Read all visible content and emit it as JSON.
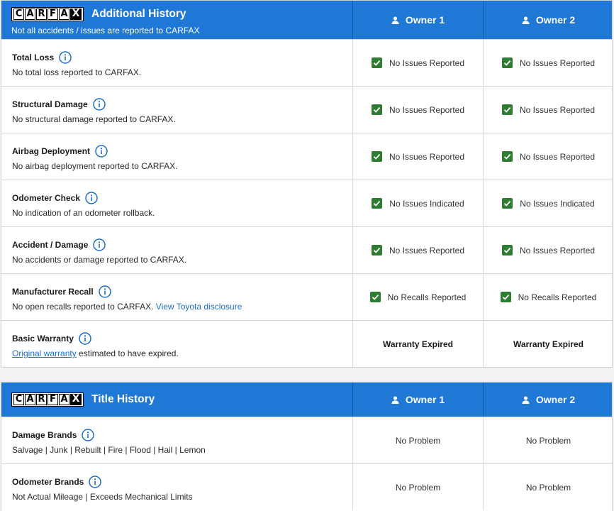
{
  "colors": {
    "header_blue": "#1f78d6",
    "check_green": "#2e7d32",
    "link_blue": "#1f6fc5"
  },
  "brand_logo": [
    "C",
    "A",
    "R",
    "F",
    "A",
    "X"
  ],
  "additional_history": {
    "title": "Additional History",
    "subtitle": "Not all accidents / issues are reported to CARFAX",
    "owners": [
      "Owner 1",
      "Owner 2"
    ],
    "rows": [
      {
        "title": "Total Loss",
        "desc": "No total loss reported to CARFAX.",
        "owner1": "No Issues Reported",
        "owner2": "No Issues Reported"
      },
      {
        "title": "Structural Damage",
        "desc": "No structural damage reported to CARFAX.",
        "owner1": "No Issues Reported",
        "owner2": "No Issues Reported"
      },
      {
        "title": "Airbag Deployment",
        "desc": "No airbag deployment reported to CARFAX.",
        "owner1": "No Issues Reported",
        "owner2": "No Issues Reported"
      },
      {
        "title": "Odometer Check",
        "desc": "No indication of an odometer rollback.",
        "owner1": "No Issues Indicated",
        "owner2": "No Issues Indicated"
      },
      {
        "title": "Accident / Damage",
        "desc": "No accidents or damage reported to CARFAX.",
        "owner1": "No Issues Reported",
        "owner2": "No Issues Reported"
      },
      {
        "title": "Manufacturer Recall",
        "desc": "No open recalls reported to CARFAX.",
        "link": "View Toyota disclosure",
        "owner1": "No Recalls Reported",
        "owner2": "No Recalls Reported"
      },
      {
        "title": "Basic Warranty",
        "link": "Original warranty",
        "desc": "estimated to have expired.",
        "owner1": "Warranty Expired",
        "owner2": "Warranty Expired"
      }
    ]
  },
  "title_history": {
    "title": "Title History",
    "owners": [
      "Owner 1",
      "Owner 2"
    ],
    "rows": [
      {
        "title": "Damage Brands",
        "desc": "Salvage | Junk | Rebuilt | Fire | Flood | Hail | Lemon",
        "owner1": "No Problem",
        "owner2": "No Problem"
      },
      {
        "title": "Odometer Brands",
        "desc": "Not Actual Mileage | Exceeds Mechanical Limits",
        "owner1": "No Problem",
        "owner2": "No Problem"
      }
    ]
  }
}
